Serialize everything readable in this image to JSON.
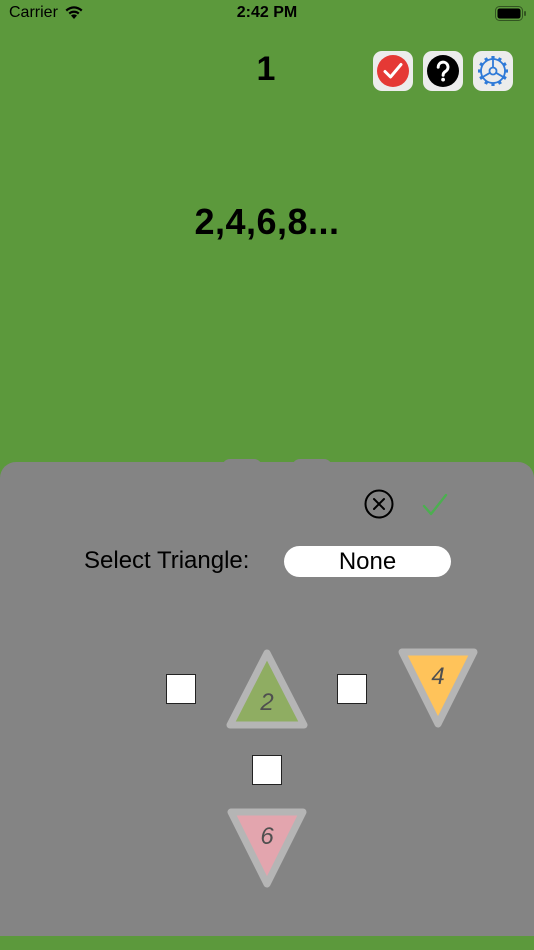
{
  "status_bar": {
    "carrier": "Carrier",
    "time": "2:42 PM"
  },
  "header": {
    "level": "1",
    "check_color": "#e53935",
    "settings_color": "#2f7ad8"
  },
  "sequence": "2,4,6,8...",
  "panel": {
    "select_label": "Select Triangle:",
    "select_value": "None",
    "confirm_color": "#4caf50"
  },
  "triangles": {
    "up": {
      "label": "2",
      "color": "#8fad62"
    },
    "orange": {
      "label": "4",
      "color": "#ffc35a"
    },
    "pink": {
      "label": "6",
      "color": "#e3a5ae"
    }
  },
  "colors": {
    "background": "#5c993c",
    "panel": "#848484",
    "triangle_border": "#b5b5b5"
  }
}
